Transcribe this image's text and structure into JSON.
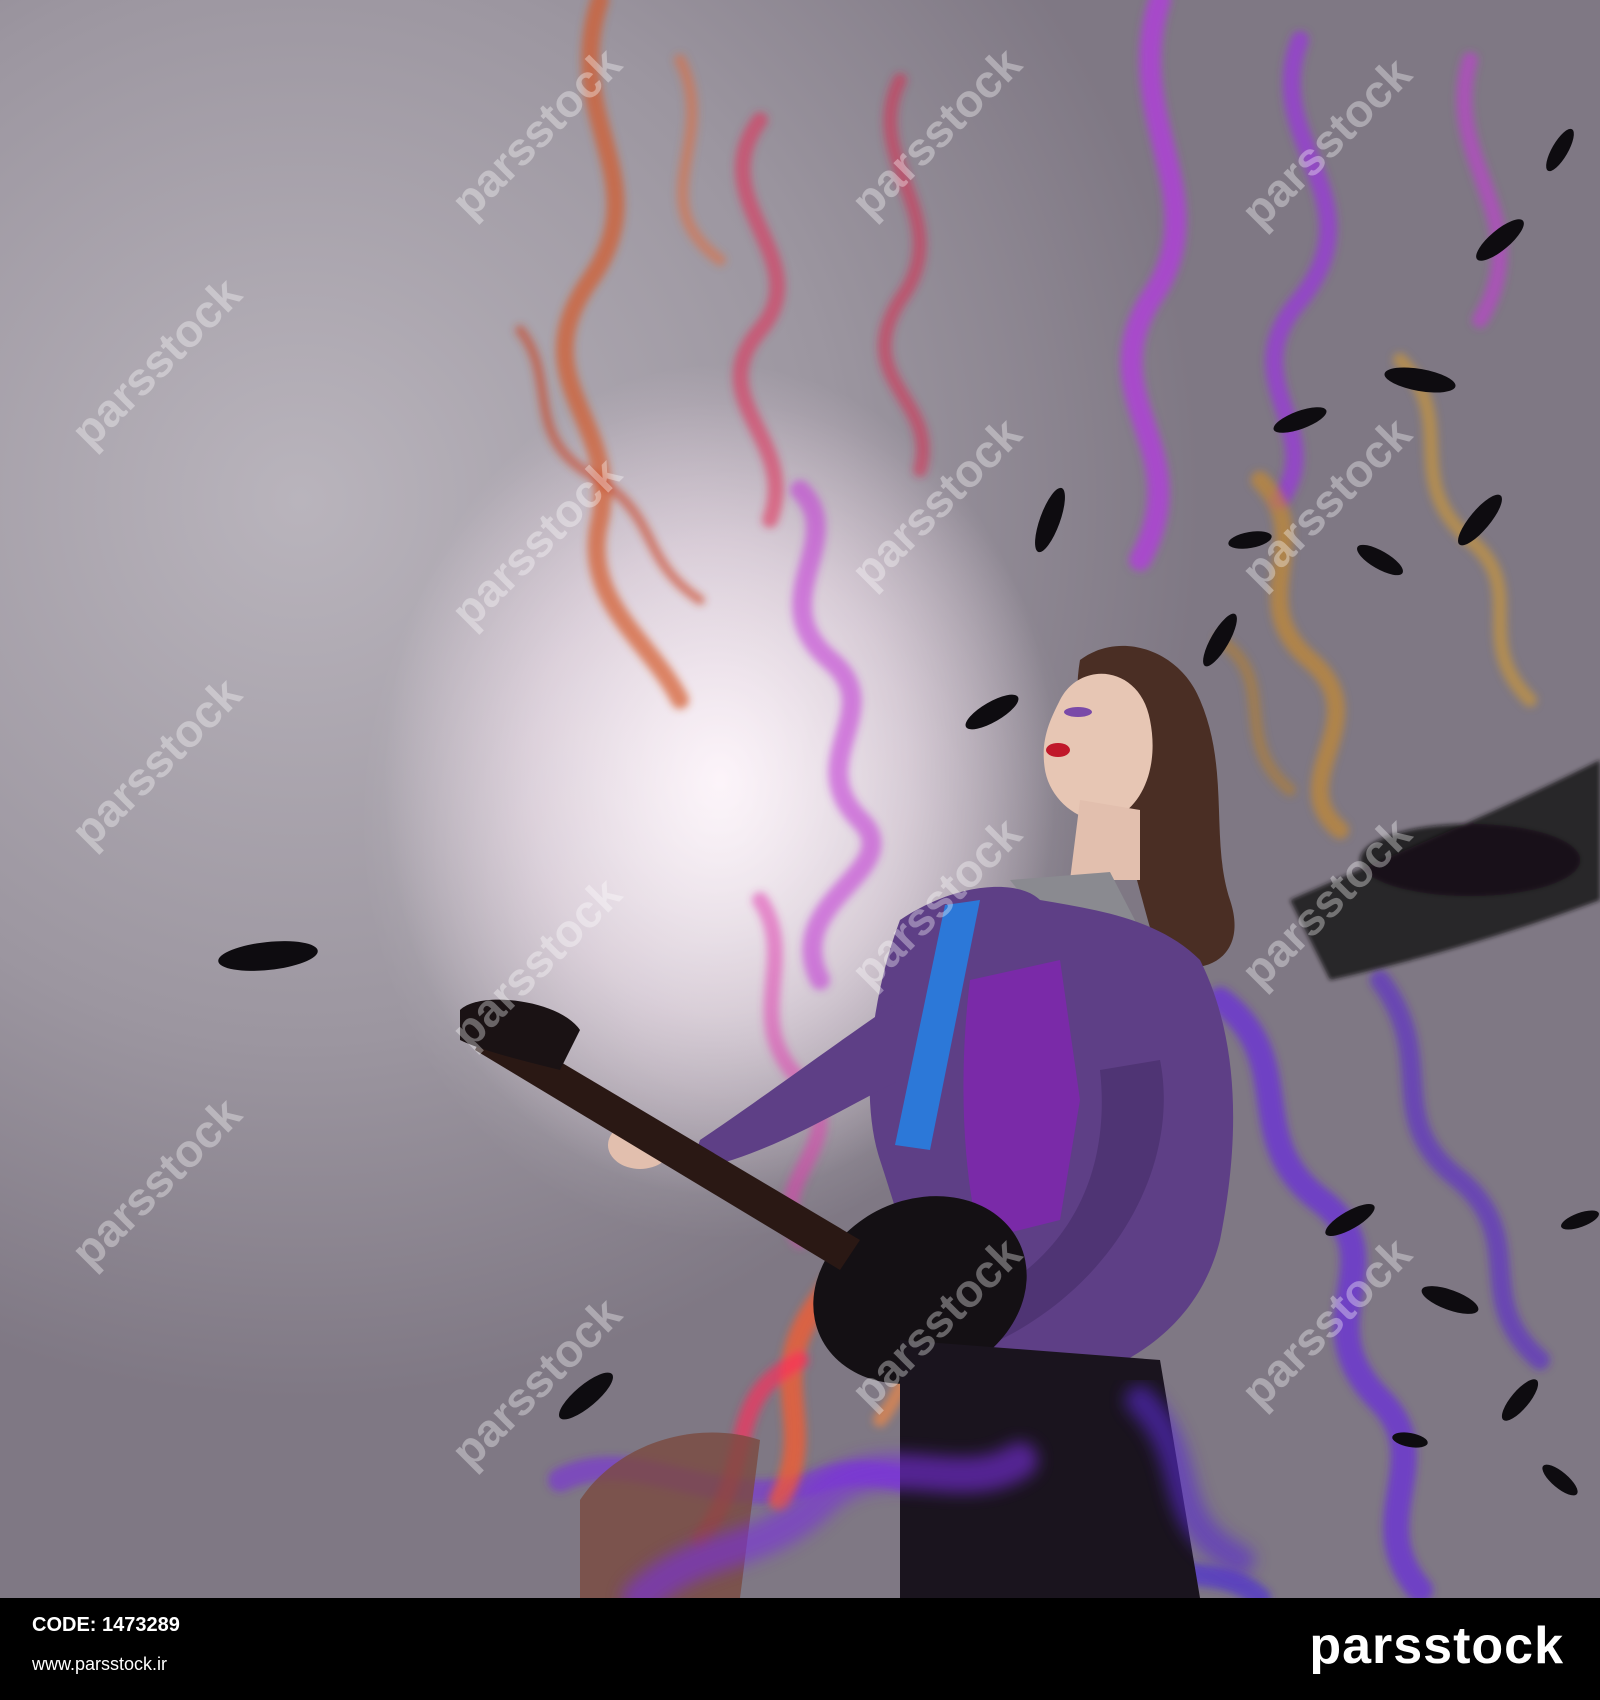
{
  "image": {
    "description_tags": [
      "woman-playing-electric-guitar",
      "colored-smoke",
      "black-feathers"
    ],
    "colors": {
      "background": "#9c96a0",
      "smoke_orange": "#d4582a",
      "smoke_red": "#e0305a",
      "smoke_magenta": "#c33cd6",
      "smoke_purple": "#7a2ee0",
      "smoke_gold": "#c98a2a",
      "jacket": "#5e3f86",
      "corset": "#7a2aa8",
      "strap": "#2c78d8",
      "footer": "#000000",
      "footer_text": "#ffffff"
    }
  },
  "watermark": {
    "text": "parsstock"
  },
  "footer": {
    "code_label": "CODE:",
    "code_value": "1473289",
    "url": "www.parsstock.ir",
    "logo": "parsstock"
  }
}
